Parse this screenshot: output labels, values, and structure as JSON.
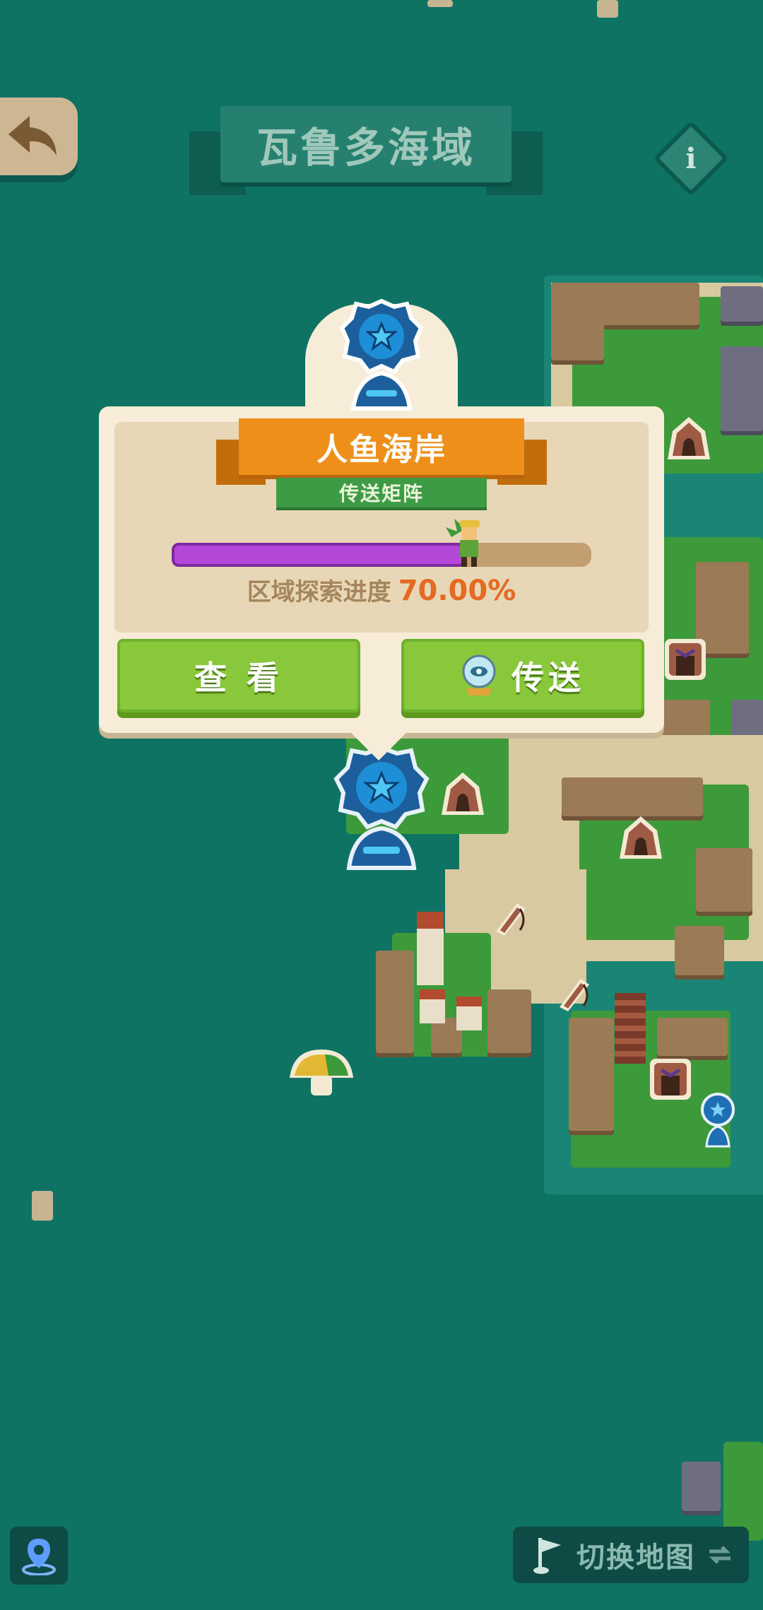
{
  "header": {
    "region_title": "瓦鲁多海域",
    "back_icon": "back-arrow-icon",
    "info_icon": "info-icon"
  },
  "popup": {
    "location_name": "人鱼海岸",
    "location_type": "传送矩阵",
    "progress_label": "区域探索进度",
    "progress_value": "70.00%",
    "progress_fraction": 0.7,
    "view_button": "查 看",
    "teleport_button": "传送"
  },
  "footer": {
    "switch_map_label": "切换地图",
    "location_icon": "map-pin-icon"
  },
  "colors": {
    "sea": "#0f7364",
    "progress_fill": "#b447d8",
    "button_green": "#88c83a",
    "banner_orange": "#ee8f1a"
  }
}
